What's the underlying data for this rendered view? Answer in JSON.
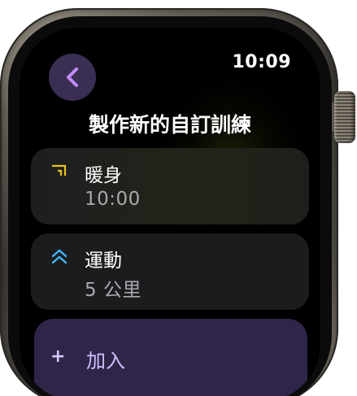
{
  "status_bar": {
    "time": "10:09"
  },
  "header": {
    "back_icon": "chevron-left-icon",
    "title": "製作新的自訂訓練"
  },
  "steps": [
    {
      "name": "暖身",
      "value": "10:00",
      "icon": "warmup-bracket-icon",
      "icon_color": "#e8c21a"
    },
    {
      "name": "運動",
      "value": "5 公里",
      "icon": "double-chevron-up-icon",
      "icon_color": "#3fb8ff"
    }
  ],
  "add_action": {
    "icon": "plus-icon",
    "label": "加入"
  },
  "colors": {
    "accent": "#c28cff",
    "back_button_bg": "#3a2f52",
    "add_button_bg": "#2f2548",
    "card_bg": "#1c1c1e"
  }
}
